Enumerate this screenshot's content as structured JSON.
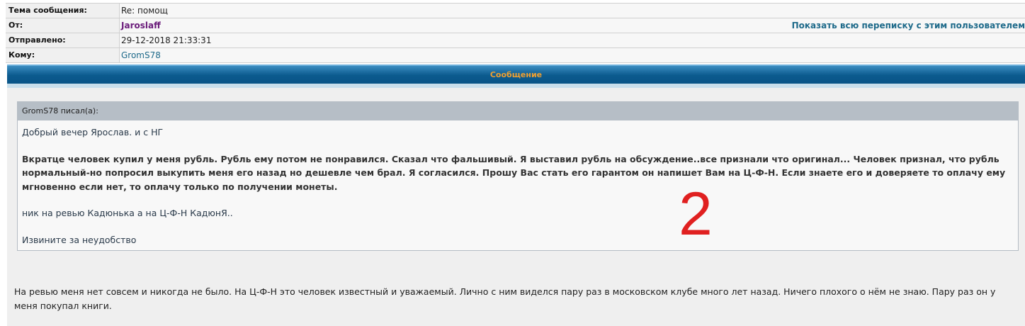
{
  "header": {
    "rows": [
      {
        "key": "Тема сообщения:",
        "value": "Re: помощ"
      },
      {
        "key": "От:",
        "value": "Jaroslaff",
        "action": "Показать всю переписку с этим пользователем"
      },
      {
        "key": "Отправлено:",
        "value": "29-12-2018 21:33:31"
      },
      {
        "key": "Кому:",
        "value": "GromS78"
      }
    ]
  },
  "banner": {
    "title": "Сообщение"
  },
  "quote": {
    "author": "GromS78 писал(а):",
    "line1": "Добрый вечер Ярослав. и с НГ",
    "line2": "Вкратце человек купил у меня рубль. Рубль ему потом не понравился. Сказал что фальшивый. Я выставил рубль на обсуждение..все признали что оригинал... Человек признал, что рубль нормальный-но попросил выкупить меня его назад но дешевле чем брал. Я согласился. Прошу Вас стать его гарантом он напишет Вам на Ц-Ф-Н. Если знаете его и доверяете то оплачу ему мгновенно если нет, то оплачу только по получении монеты.",
    "line3": "ник на ревью Кадюнька а на Ц-Ф-Н КадюнЯ..",
    "line4": "Извините за неудобство"
  },
  "annotation": {
    "text": "2",
    "color": "#e02020"
  },
  "reply": {
    "text": "На ревью меня нет совсем и никогда не было. На Ц-Ф-Н это человек известный и уважаемый. Лично с ним виделся пару раз в московском клубе много лет назад. Ничего плохого о нём не знаю. Пару раз он у меня покупал книги."
  },
  "colors": {
    "banner_bg": "#0b5a8e",
    "banner_text": "#f0a030",
    "link": "#1e6a8a",
    "author": "#6a1b7a"
  }
}
